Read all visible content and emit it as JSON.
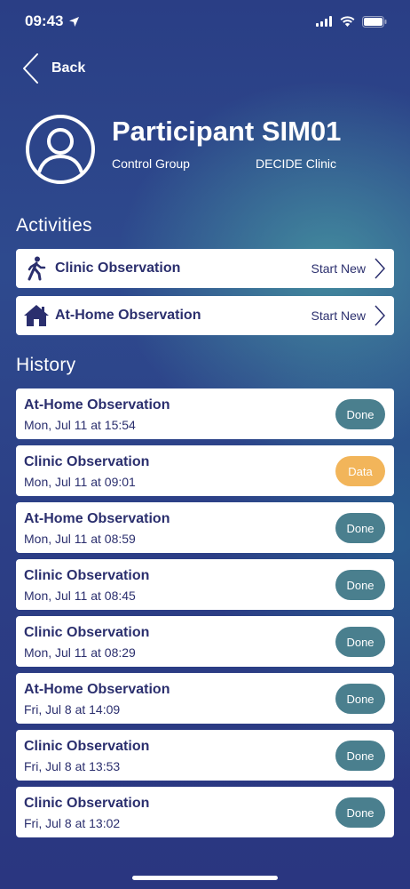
{
  "status_bar": {
    "time": "09:43"
  },
  "nav": {
    "back_label": "Back"
  },
  "participant": {
    "title": "Participant SIM01",
    "group": "Control Group",
    "clinic": "DECIDE Clinic"
  },
  "activities": {
    "heading": "Activities",
    "items": [
      {
        "label": "Clinic Observation",
        "action": "Start New",
        "icon": "walking-person-icon"
      },
      {
        "label": "At-Home Observation",
        "action": "Start New",
        "icon": "home-icon"
      }
    ]
  },
  "history": {
    "heading": "History",
    "items": [
      {
        "title": "At-Home Observation",
        "date": "Mon, Jul 11 at 15:54",
        "status": "Done"
      },
      {
        "title": "Clinic Observation",
        "date": "Mon, Jul 11 at 09:01",
        "status": "Data"
      },
      {
        "title": "At-Home Observation",
        "date": "Mon, Jul 11 at 08:59",
        "status": "Done"
      },
      {
        "title": "Clinic Observation",
        "date": "Mon, Jul 11 at 08:45",
        "status": "Done"
      },
      {
        "title": "Clinic Observation",
        "date": "Mon, Jul 11 at 08:29",
        "status": "Done"
      },
      {
        "title": "At-Home Observation",
        "date": "Fri, Jul 8 at 14:09",
        "status": "Done"
      },
      {
        "title": "Clinic Observation",
        "date": "Fri, Jul 8 at 13:53",
        "status": "Done"
      },
      {
        "title": "Clinic Observation",
        "date": "Fri, Jul 8 at 13:02",
        "status": "Done"
      }
    ]
  },
  "colors": {
    "done_badge": "#4a7f8e",
    "data_badge": "#f2b55a",
    "card_text": "#2b2f6e"
  }
}
